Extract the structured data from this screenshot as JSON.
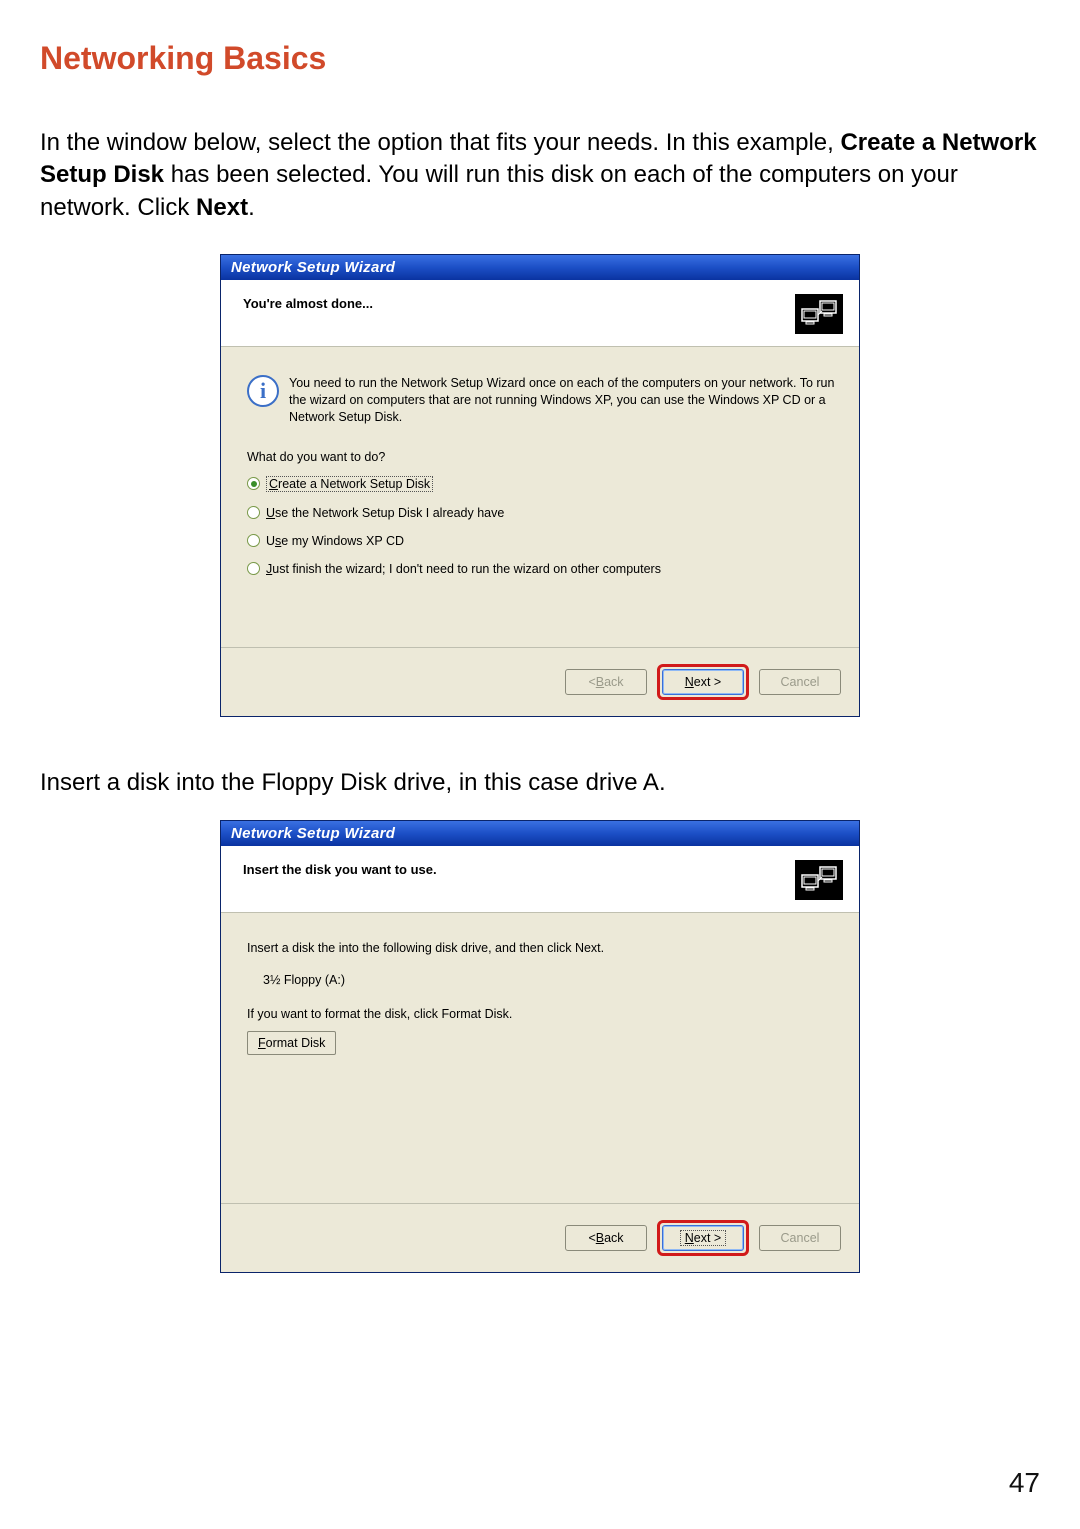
{
  "page": {
    "title": "Networking Basics",
    "intro_pre": "In the window below, select the option that fits your needs.  In this example, ",
    "intro_bold1": "Create a Network Setup Disk",
    "intro_mid": " has been selected.  You will run this disk on each of the computers on your network.  Click ",
    "intro_bold2": "Next",
    "intro_post": ".",
    "mid_text": "Insert a disk into the Floppy Disk drive, in this case drive A.",
    "page_number": "47"
  },
  "wiz1": {
    "titlebar": "Network Setup Wizard",
    "subtitle": "You're almost done...",
    "info": "You need to run the Network Setup Wizard once on each of the computers on your network. To run the wizard on computers that are not running Windows XP, you can use the Windows XP CD or a Network Setup Disk.",
    "question": "What do you want to do?",
    "opt1_u": "C",
    "opt1_rest": "reate a Network Setup Disk",
    "opt2_u": "U",
    "opt2_rest": "se the Network Setup Disk I already have",
    "opt3_pre": "U",
    "opt3_u": "s",
    "opt3_rest": "e my Windows XP CD",
    "opt4_u": "J",
    "opt4_rest": "ust finish the wizard; I don't need to run the wizard on other computers",
    "back_lt": "< ",
    "back_u": "B",
    "back_rest": "ack",
    "next_u": "N",
    "next_rest": "ext >",
    "cancel": "Cancel"
  },
  "wiz2": {
    "titlebar": "Network Setup Wizard",
    "subtitle": "Insert the disk you want to use.",
    "line1": "Insert a disk the into the following disk drive, and then click Next.",
    "drive": "3½ Floppy (A:)",
    "line2": "If you want to format the disk, click Format Disk.",
    "fmt_u": "F",
    "fmt_rest": "ormat Disk",
    "back_lt": "< ",
    "back_u": "B",
    "back_rest": "ack",
    "next_u": "N",
    "next_rest": "ext >",
    "cancel": "Cancel"
  }
}
